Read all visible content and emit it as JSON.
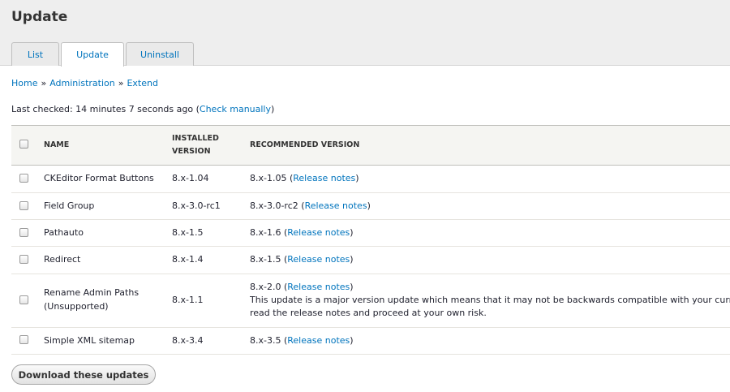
{
  "page": {
    "title": "Update"
  },
  "tabs": [
    {
      "label": "List"
    },
    {
      "label": "Update"
    },
    {
      "label": "Uninstall"
    }
  ],
  "breadcrumb": [
    {
      "label": "Home"
    },
    {
      "label": "Administration"
    },
    {
      "label": "Extend"
    }
  ],
  "breadcrumb_separator": "»",
  "last_checked": {
    "text": "Last checked: 14 minutes 7 seconds ago",
    "open_paren": " (",
    "link": "Check manually",
    "close_paren": ")"
  },
  "table": {
    "headers": {
      "name": "NAME",
      "installed_line1": "INSTALLED",
      "installed_line2": "VERSION",
      "recommended": "RECOMMENDED VERSION"
    },
    "rows": [
      {
        "name": "CKEditor Format Buttons",
        "installed": "8.x-1.04",
        "recommended": "8.x-1.05",
        "notes": "Release notes"
      },
      {
        "name": "Field Group",
        "installed": "8.x-3.0-rc1",
        "recommended": "8.x-3.0-rc2",
        "notes": "Release notes"
      },
      {
        "name": "Pathauto",
        "installed": "8.x-1.5",
        "recommended": "8.x-1.6",
        "notes": "Release notes"
      },
      {
        "name": "Redirect",
        "installed": "8.x-1.4",
        "recommended": "8.x-1.5",
        "notes": "Release notes"
      },
      {
        "name": "Rename Admin Paths",
        "sub": "(Unsupported)",
        "installed": "8.x-1.1",
        "recommended": "8.x-2.0",
        "notes": "Release notes",
        "warning_line1": "This update is a major version update which means that it may not be backwards compatible with your currently ru",
        "warning_line2": "read the release notes and proceed at your own risk."
      },
      {
        "name": "Simple XML sitemap",
        "installed": "8.x-3.4",
        "recommended": "8.x-3.5",
        "notes": "Release notes"
      }
    ]
  },
  "actions": {
    "download": "Download these updates"
  },
  "colors": {
    "link": "#0074bd",
    "header_bg": "#eeeeee",
    "table_header_bg": "#f5f5f2"
  }
}
